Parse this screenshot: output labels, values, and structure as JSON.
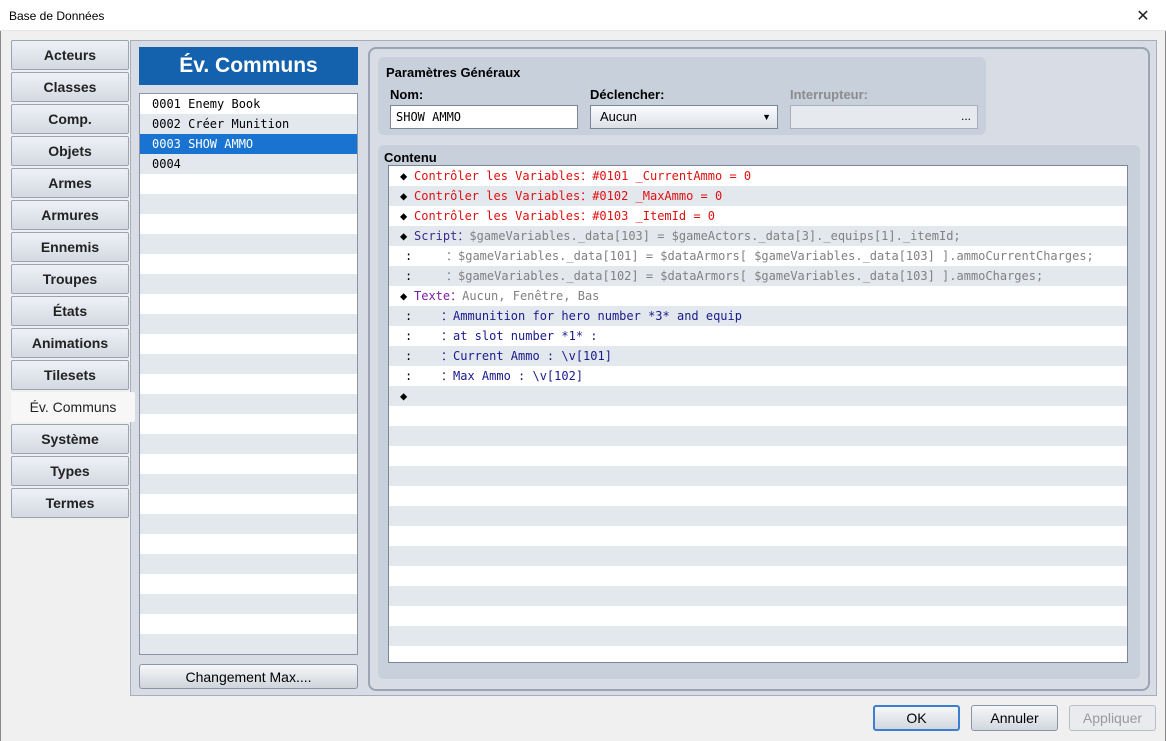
{
  "window": {
    "title": "Base de Données",
    "close_glyph": "✕"
  },
  "tabs": [
    {
      "label": "Acteurs"
    },
    {
      "label": "Classes"
    },
    {
      "label": "Comp."
    },
    {
      "label": "Objets"
    },
    {
      "label": "Armes"
    },
    {
      "label": "Armures"
    },
    {
      "label": "Ennemis"
    },
    {
      "label": "Troupes"
    },
    {
      "label": "États"
    },
    {
      "label": "Animations"
    },
    {
      "label": "Tilesets"
    },
    {
      "label": "Év. Communs",
      "active": true
    },
    {
      "label": "Système"
    },
    {
      "label": "Types"
    },
    {
      "label": "Termes"
    }
  ],
  "events": {
    "header": "Év. Communs",
    "items": [
      {
        "label": "0001 Enemy Book"
      },
      {
        "label": "0002 Créer Munition"
      },
      {
        "label": "0003 SHOW AMMO",
        "selected": true
      },
      {
        "label": "0004"
      }
    ],
    "max_button": "Changement Max...."
  },
  "general": {
    "title": "Paramètres Généraux",
    "name_label": "Nom:",
    "name_value": "SHOW AMMO",
    "trigger_label": "Déclencher:",
    "trigger_value": "Aucun",
    "switch_label": "Interrupteur:",
    "switch_value": "",
    "dots": "..."
  },
  "contents": {
    "title": "Contenu",
    "lines": [
      {
        "lead": "◆",
        "head": "Contrôler les Variables",
        "head_color": "red",
        "body": "#0101 _CurrentAmmo = 0",
        "body_color": "red"
      },
      {
        "lead": "◆",
        "head": "Contrôler les Variables",
        "head_color": "red",
        "body": "#0102 _MaxAmmo = 0",
        "body_color": "red"
      },
      {
        "lead": "◆",
        "head": "Contrôler les Variables",
        "head_color": "red",
        "body": "#0103 _ItemId = 0",
        "body_color": "red"
      },
      {
        "lead": "◆",
        "head": "Script",
        "head_color": "script",
        "body": "$gameVariables._data[103] = $gameActors._data[3]._equips[1]._itemId;",
        "body_color": "gray"
      },
      {
        "lead": ":",
        "head": "",
        "head_color": "gray",
        "body": "$gameVariables._data[101] = $dataArmors[ $gameVariables._data[103] ].ammoCurrentCharges;",
        "body_color": "gray"
      },
      {
        "lead": ":",
        "head": "",
        "head_color": "gray",
        "body": "$gameVariables._data[102] = $dataArmors[ $gameVariables._data[103] ].ammoCharges;",
        "body_color": "gray"
      },
      {
        "lead": "◆",
        "head": "Texte",
        "head_color": "purple",
        "body": "Aucun, Fenêtre, Bas",
        "body_color": "gray"
      },
      {
        "lead": ":",
        "head": "",
        "head_color": "navy",
        "body": "Ammunition for hero number *3* and equip",
        "body_color": "navy"
      },
      {
        "lead": ":",
        "head": "",
        "head_color": "navy",
        "body": "at slot number *1* :",
        "body_color": "navy"
      },
      {
        "lead": ":",
        "head": "",
        "head_color": "navy",
        "body": "Current Ammo : \\v[101]",
        "body_color": "navy"
      },
      {
        "lead": ":",
        "head": "",
        "head_color": "navy",
        "body": "Max Ammo : \\v[102]",
        "body_color": "navy"
      },
      {
        "lead": "◆",
        "head": "",
        "head_color": "navy",
        "body": "",
        "body_color": "navy"
      }
    ]
  },
  "buttons": {
    "ok": "OK",
    "cancel": "Annuler",
    "apply": "Appliquer"
  }
}
